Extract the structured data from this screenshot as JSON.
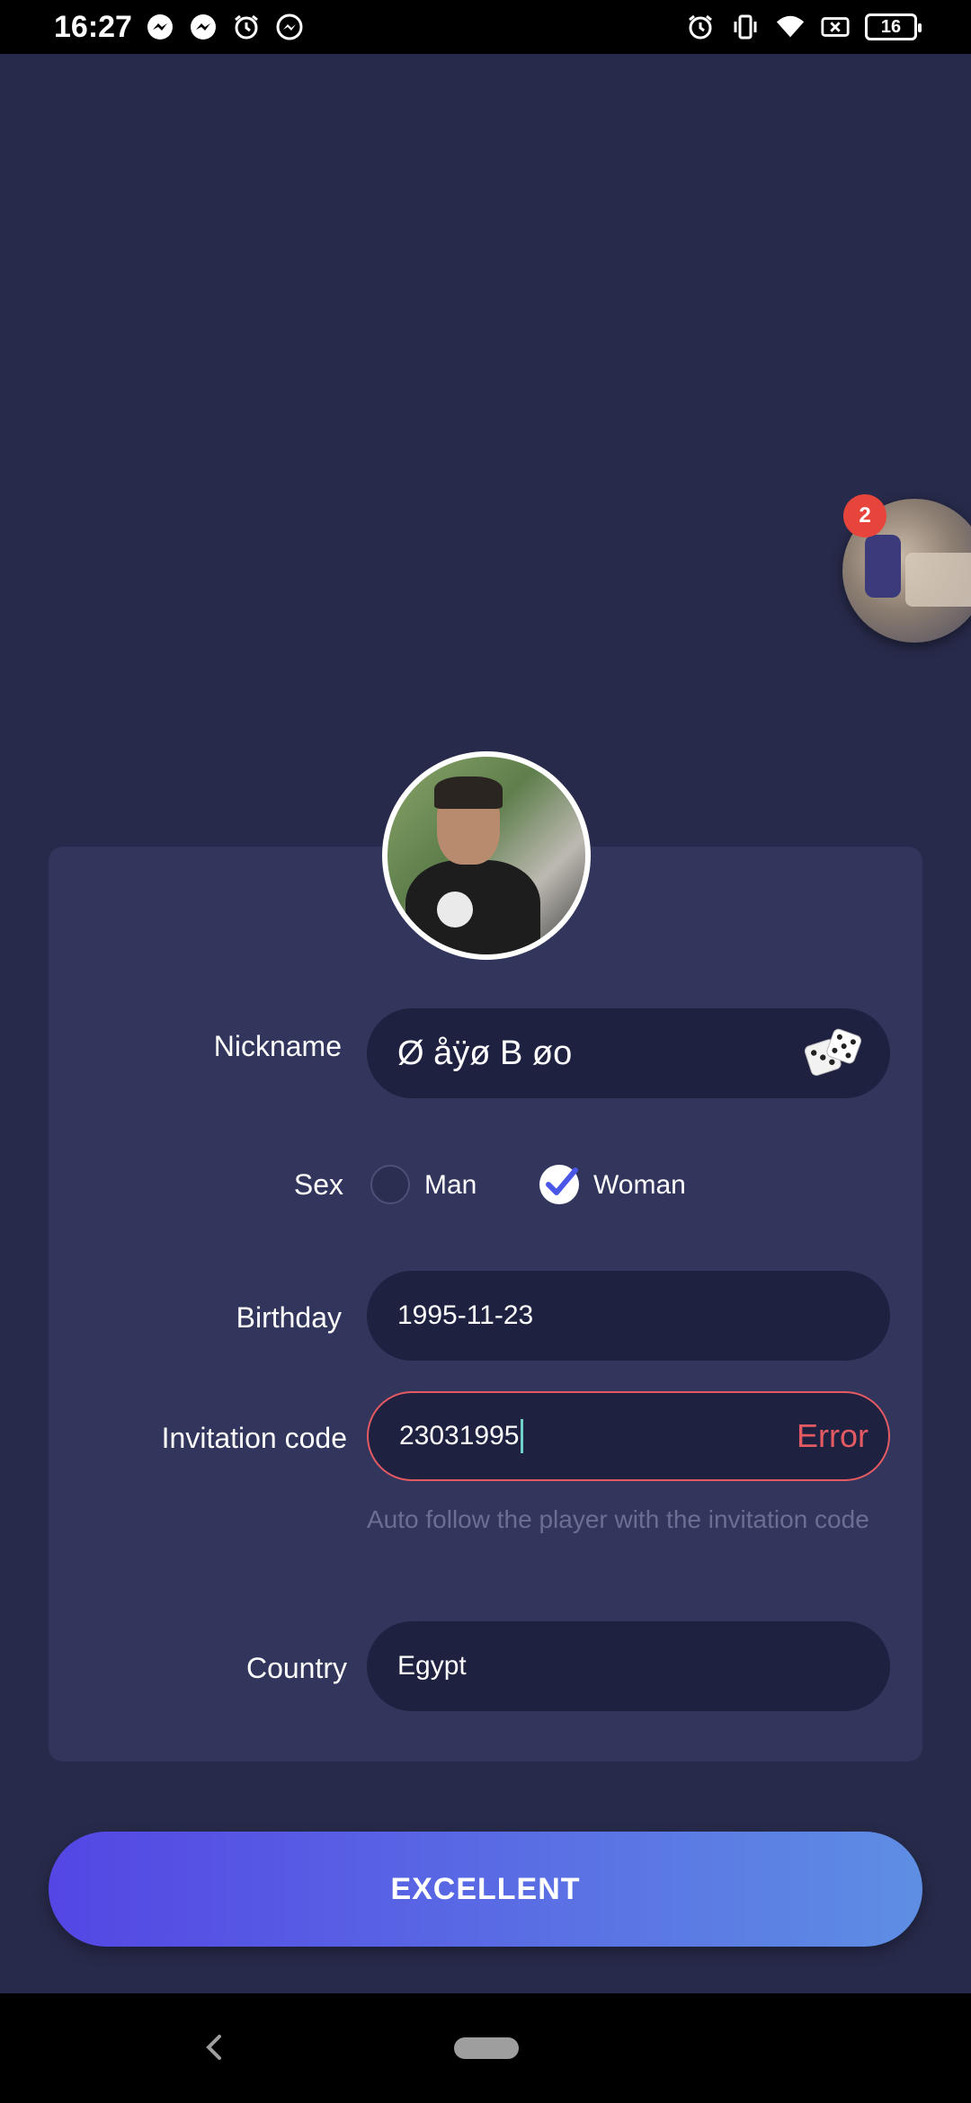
{
  "status_bar": {
    "time": "16:27",
    "left_icons": [
      "messenger-icon",
      "messenger-icon",
      "alarm-icon",
      "messenger-icon"
    ],
    "right_icons": [
      "alarm-icon",
      "vibrate-icon",
      "wifi-icon",
      "no-sim-icon",
      "battery-icon"
    ],
    "battery_level": "16"
  },
  "floating_bubble": {
    "badge_count": "2"
  },
  "form": {
    "nickname": {
      "label": "Nickname",
      "value": "Ø åÿø B øo",
      "action_icon": "dice-icon"
    },
    "sex": {
      "label": "Sex",
      "options": [
        {
          "label": "Man",
          "selected": false
        },
        {
          "label": "Woman",
          "selected": true
        }
      ]
    },
    "birthday": {
      "label": "Birthday",
      "value": "1995-11-23"
    },
    "invitation_code": {
      "label": "Invitation code",
      "value": "23031995",
      "error": "Error",
      "hint": "Auto follow the player with the invitation code"
    },
    "country": {
      "label": "Country",
      "value": "Egypt"
    }
  },
  "submit_button": {
    "label": "EXCELLENT"
  },
  "colors": {
    "background": "#272a4a",
    "card": "#33365c",
    "field": "#1f2140",
    "error": "#e35a63",
    "button_start": "#5446e4",
    "button_end": "#5e8ee4",
    "hint": "#6b6f93"
  }
}
